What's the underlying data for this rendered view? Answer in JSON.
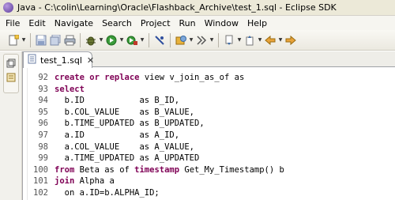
{
  "window": {
    "title": "Java - C:\\colin\\Learning\\Oracle\\Flashback_Archive\\test_1.sql - Eclipse SDK"
  },
  "menu": [
    "File",
    "Edit",
    "Navigate",
    "Search",
    "Project",
    "Run",
    "Window",
    "Help"
  ],
  "toolbar": {
    "buttons": [
      "new-icon",
      "save-icon",
      "save-all-icon",
      "print-icon",
      "debug-icon",
      "run-icon",
      "external-tools-icon",
      "open-type-icon",
      "open-task-icon",
      "new-java-class-icon",
      "next-annotation-icon",
      "previous-annotation-icon",
      "back-icon",
      "forward-icon"
    ]
  },
  "editor": {
    "tab_label": "test_1.sql",
    "tab_close": "✕",
    "lines": [
      {
        "n": "92",
        "segments": [
          [
            "kw",
            "create"
          ],
          [
            "t",
            " "
          ],
          [
            "kw",
            "or"
          ],
          [
            "t",
            " "
          ],
          [
            "kw",
            "replace"
          ],
          [
            "t",
            " view v_join_as_of as"
          ]
        ]
      },
      {
        "n": "93",
        "segments": [
          [
            "kw",
            "select"
          ]
        ]
      },
      {
        "n": "94",
        "segments": [
          [
            "t",
            "  b.ID           as B_ID,"
          ]
        ]
      },
      {
        "n": "95",
        "segments": [
          [
            "t",
            "  b.COL_VALUE    as B_VALUE,"
          ]
        ]
      },
      {
        "n": "96",
        "segments": [
          [
            "t",
            "  b.TIME_UPDATED as B_UPDATED,"
          ]
        ]
      },
      {
        "n": "97",
        "segments": [
          [
            "t",
            "  a.ID           as A_ID,"
          ]
        ]
      },
      {
        "n": "98",
        "segments": [
          [
            "t",
            "  a.COL_VALUE    as A_VALUE,"
          ]
        ]
      },
      {
        "n": "99",
        "segments": [
          [
            "t",
            "  a.TIME_UPDATED as A_UPDATED"
          ]
        ]
      },
      {
        "n": "100",
        "segments": [
          [
            "kw",
            "from"
          ],
          [
            "t",
            " Beta as of "
          ],
          [
            "kw",
            "timestamp"
          ],
          [
            "t",
            " Get_My_Timestamp() b"
          ]
        ]
      },
      {
        "n": "101",
        "segments": [
          [
            "kw",
            "join"
          ],
          [
            "t",
            " Alpha a"
          ]
        ]
      },
      {
        "n": "102",
        "segments": [
          [
            "t",
            "  on a.ID=b.ALPHA_ID;"
          ]
        ]
      }
    ]
  },
  "colors": {
    "keyword": "#7f0055",
    "window_bg": "#ece9d8"
  }
}
